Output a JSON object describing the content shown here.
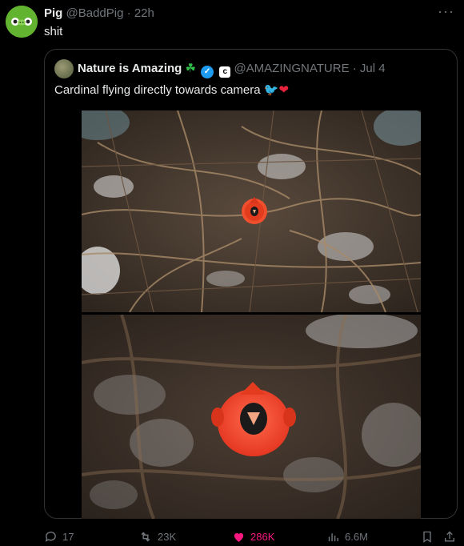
{
  "post": {
    "author_name": "Pig",
    "author_handle": "@BaddPig",
    "separator": "·",
    "time": "22h",
    "text": "shit",
    "more_icon": "more-icon"
  },
  "quoted": {
    "author_name": "Nature is Amazing",
    "clover": "☘",
    "verified_icon": "verified-badge-icon",
    "affiliate_label": "c",
    "author_handle": "@AMAZINGNATURE",
    "separator": "·",
    "date": "Jul 4",
    "text": "Cardinal flying directly towards camera",
    "emoji_bird": "🐦",
    "emoji_heart": "❤",
    "media": [
      {
        "description_name": "cardinal-video-frame-far"
      },
      {
        "description_name": "cardinal-video-frame-near"
      }
    ]
  },
  "actions": {
    "replies": "17",
    "reposts": "23K",
    "likes": "286K",
    "views": "6.6M"
  },
  "colors": {
    "background": "#000000",
    "text": "#e7e9ea",
    "muted": "#71767b",
    "like_pink": "#f91880",
    "verified_blue": "#1d9bf0",
    "avatar_green": "#6db33f"
  }
}
